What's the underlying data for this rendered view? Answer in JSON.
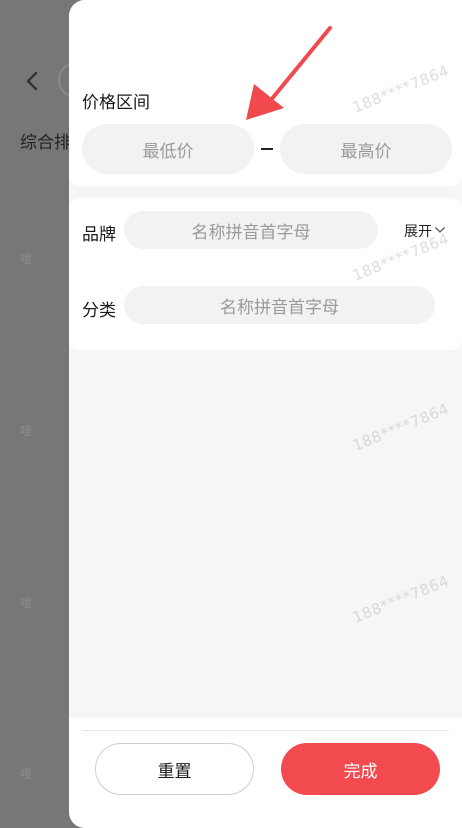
{
  "background": {
    "sort_label": "综合排",
    "tag_char": "嗖"
  },
  "price": {
    "title": "价格区间",
    "min_placeholder": "最低价",
    "max_placeholder": "最高价"
  },
  "filters": {
    "brand_label": "品牌",
    "brand_placeholder": "名称拼音首字母",
    "expand_label": "展开",
    "category_label": "分类",
    "category_placeholder": "名称拼音首字母"
  },
  "footer": {
    "reset_label": "重置",
    "done_label": "完成"
  },
  "watermark": {
    "text": "188****7864"
  },
  "colors": {
    "accent": "#f24a4f",
    "annotation_arrow": "#f04a4f"
  },
  "icons": {
    "back": "chevron-left-icon",
    "expand": "chevron-down-icon",
    "annotation": "red-arrow-icon"
  }
}
